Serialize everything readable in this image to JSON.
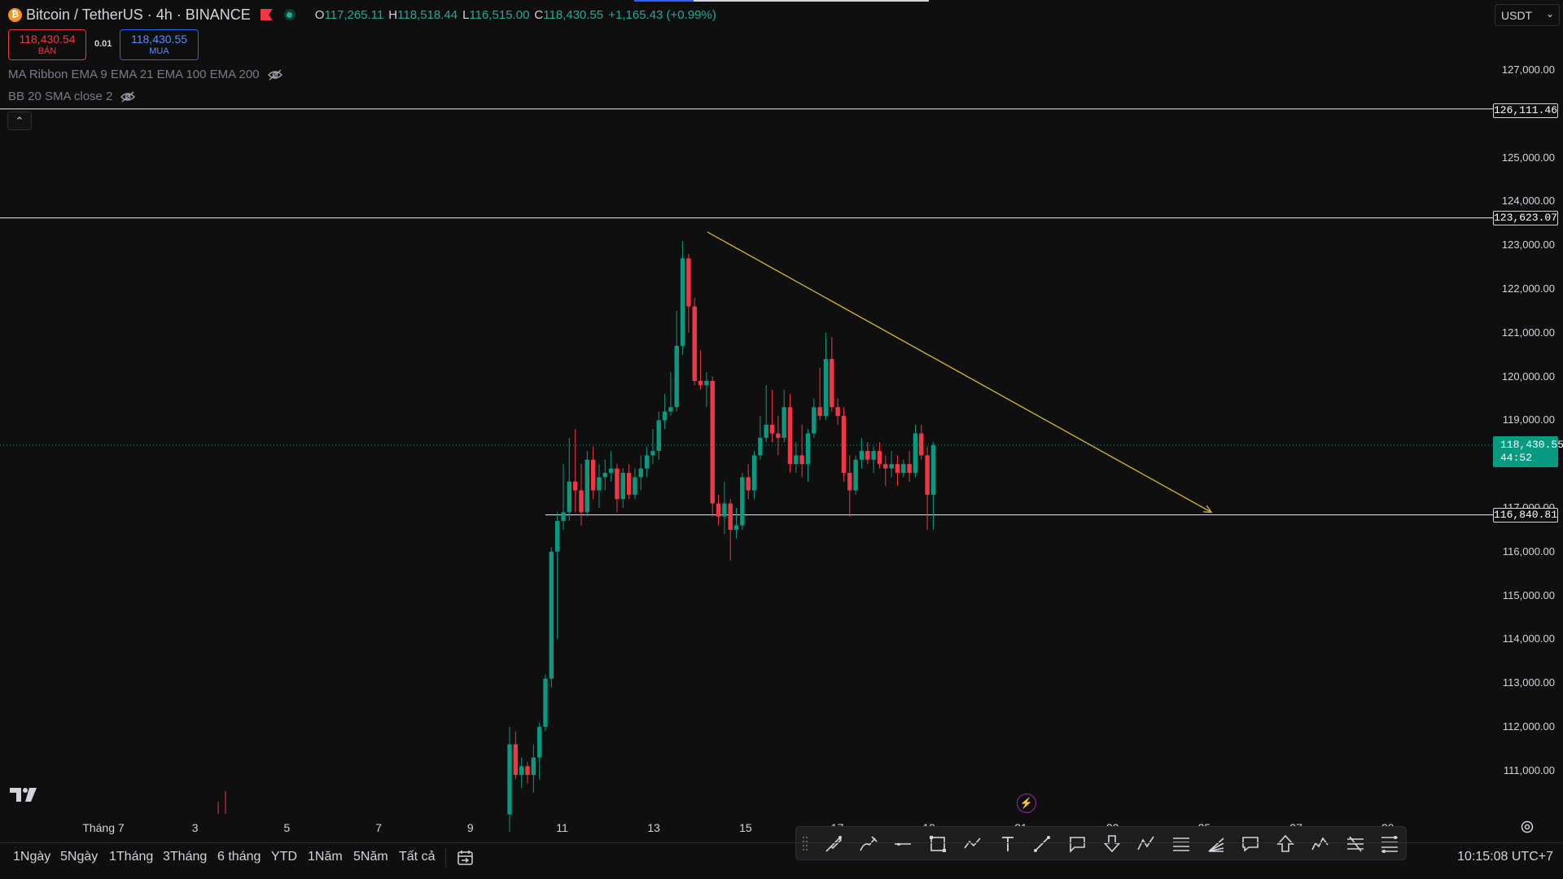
{
  "header": {
    "symbol": "Bitcoin / TetherUS · 4h · BINANCE",
    "ohlc": [
      {
        "k": "O",
        "v": "117,265.11"
      },
      {
        "k": "H",
        "v": "118,518.44"
      },
      {
        "k": "L",
        "v": "116,515.00"
      },
      {
        "k": "C",
        "v": "118,430.55"
      }
    ],
    "change": "+1,165.43 (+0.99%)"
  },
  "trade": {
    "sell_price": "118,430.54",
    "sell_label": "BÁN",
    "spread": "0.01",
    "buy_price": "118,430.55",
    "buy_label": "MUA"
  },
  "indicators": [
    {
      "label": "MA Ribbon EMA 9 EMA 21 EMA 100 EMA 200"
    },
    {
      "label": "BB 20 SMA close 2"
    }
  ],
  "price_axis": {
    "currency": "USDT",
    "ticks": [
      "127,000.00",
      "125,000.00",
      "124,000.00",
      "123,000.00",
      "122,000.00",
      "121,000.00",
      "120,000.00",
      "119,000.00",
      "117,000.00",
      "116,000.00",
      "115,000.00",
      "114,000.00",
      "113,000.00",
      "112,000.00",
      "111,000.00"
    ],
    "level_tags": [
      "126,111.46",
      "123,623.07",
      "116,840.81"
    ],
    "current_price": "118,430.55",
    "countdown": "44:52"
  },
  "time_axis": {
    "ticks": [
      "Tháng 7",
      "3",
      "5",
      "7",
      "9",
      "11",
      "13",
      "15",
      "17",
      "19",
      "21",
      "23",
      "25",
      "27",
      "29"
    ]
  },
  "range_buttons": [
    "1Ngày",
    "5Ngày",
    "1Tháng",
    "3Tháng",
    "6 tháng",
    "YTD",
    "1Năm",
    "5Năm",
    "Tất cả"
  ],
  "clock": "10:15:08 UTC+7",
  "colors": {
    "up": "#089981",
    "down": "#f23645",
    "trendline": "#c9b12f",
    "level": "#d1d4dc"
  },
  "icons": [
    "bitcoin-icon",
    "flag-icon",
    "market-open-icon",
    "eye-off-icon",
    "chevron-up-icon",
    "tradingview-logo-icon",
    "bolt-icon",
    "settings-icon",
    "goto-date-icon"
  ],
  "chart_data": {
    "type": "candlestick",
    "timeframe": "4h",
    "ylim": [
      110000,
      128000
    ],
    "horizontal_levels": [
      126111.46,
      123623.07,
      116840.81
    ],
    "trendline": {
      "from": [
        123300,
        "14 Jul"
      ],
      "to": [
        116900,
        "26 Jul"
      ],
      "arrow": true
    },
    "candles": [
      [
        110000,
        112000,
        109600,
        111600
      ],
      [
        111600,
        111900,
        110800,
        110900
      ],
      [
        110900,
        111300,
        110600,
        111100
      ],
      [
        111100,
        111200,
        110700,
        110900
      ],
      [
        110900,
        111600,
        110500,
        111300
      ],
      [
        111300,
        112100,
        110800,
        112000
      ],
      [
        112000,
        113200,
        111900,
        113100
      ],
      [
        113100,
        116100,
        112900,
        116000
      ],
      [
        116000,
        116900,
        114000,
        116700
      ],
      [
        116700,
        118000,
        116500,
        116900
      ],
      [
        116900,
        118600,
        116700,
        117600
      ],
      [
        117600,
        118800,
        116900,
        117400
      ],
      [
        117400,
        118000,
        116600,
        116900
      ],
      [
        116900,
        118300,
        116800,
        118100
      ],
      [
        118100,
        118400,
        117200,
        117400
      ],
      [
        117400,
        118000,
        117000,
        117700
      ],
      [
        117700,
        118100,
        117400,
        117800
      ],
      [
        117800,
        118300,
        117600,
        117900
      ],
      [
        117900,
        118000,
        116900,
        117200
      ],
      [
        117200,
        117900,
        117000,
        117800
      ],
      [
        117800,
        118000,
        117200,
        117300
      ],
      [
        117300,
        117900,
        117200,
        117700
      ],
      [
        117700,
        118200,
        117400,
        117900
      ],
      [
        117900,
        118400,
        117700,
        118200
      ],
      [
        118200,
        118800,
        118000,
        118300
      ],
      [
        118300,
        119200,
        118100,
        119000
      ],
      [
        119000,
        119600,
        118800,
        119200
      ],
      [
        119200,
        120100,
        119100,
        119300
      ],
      [
        119300,
        121500,
        119200,
        120700
      ],
      [
        120700,
        123100,
        120500,
        122700
      ],
      [
        122700,
        122800,
        121000,
        121600
      ],
      [
        121600,
        121800,
        119800,
        119900
      ],
      [
        119900,
        120600,
        119700,
        119800
      ],
      [
        119800,
        120100,
        119300,
        119900
      ],
      [
        119900,
        120000,
        116800,
        117100
      ],
      [
        117100,
        117300,
        116600,
        116800
      ],
      [
        116800,
        117600,
        116400,
        117100
      ],
      [
        117100,
        117200,
        115800,
        116500
      ],
      [
        116500,
        117000,
        116300,
        116600
      ],
      [
        116600,
        117800,
        116500,
        117700
      ],
      [
        117700,
        118000,
        117200,
        117400
      ],
      [
        117400,
        118300,
        117200,
        118200
      ],
      [
        118200,
        119100,
        118100,
        118600
      ],
      [
        118600,
        119800,
        118500,
        118900
      ],
      [
        118900,
        119700,
        118500,
        118700
      ],
      [
        118700,
        119100,
        118200,
        118600
      ],
      [
        118600,
        119700,
        118500,
        119300
      ],
      [
        119300,
        119600,
        117800,
        118000
      ],
      [
        118000,
        118500,
        117800,
        118200
      ],
      [
        118200,
        118900,
        117700,
        118000
      ],
      [
        118000,
        118800,
        117600,
        118700
      ],
      [
        118700,
        119500,
        118600,
        119300
      ],
      [
        119300,
        120200,
        119000,
        119100
      ],
      [
        119100,
        121000,
        119000,
        120400
      ],
      [
        120400,
        120900,
        119200,
        119300
      ],
      [
        119300,
        119500,
        118900,
        119100
      ],
      [
        119100,
        119300,
        117600,
        117800
      ],
      [
        117800,
        118200,
        116800,
        117400
      ],
      [
        117400,
        118200,
        117300,
        118100
      ],
      [
        118100,
        118600,
        117900,
        118300
      ],
      [
        118300,
        118500,
        118000,
        118100
      ],
      [
        118100,
        118400,
        117800,
        118300
      ],
      [
        118300,
        118500,
        117900,
        118000
      ],
      [
        118000,
        118200,
        117500,
        117900
      ],
      [
        117900,
        118300,
        117700,
        118000
      ],
      [
        118000,
        118200,
        117500,
        117800
      ],
      [
        117800,
        118100,
        117700,
        118000
      ],
      [
        118000,
        118300,
        117600,
        117800
      ],
      [
        117800,
        118900,
        117700,
        118700
      ],
      [
        118700,
        118900,
        118100,
        118200
      ],
      [
        118200,
        118400,
        116500,
        117300
      ],
      [
        117300,
        118500,
        116500,
        118430
      ]
    ]
  }
}
